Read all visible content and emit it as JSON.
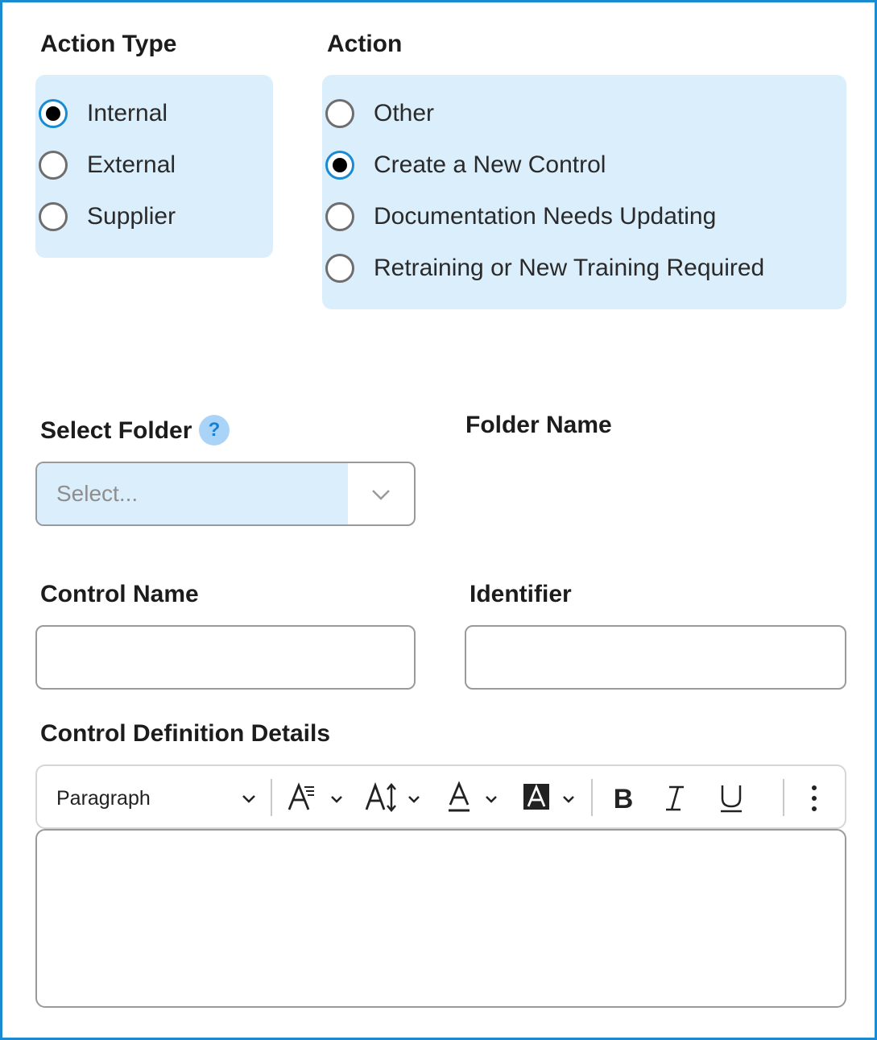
{
  "action_type": {
    "title": "Action Type",
    "options": [
      {
        "label": "Internal",
        "checked": true
      },
      {
        "label": "External",
        "checked": false
      },
      {
        "label": "Supplier",
        "checked": false
      }
    ]
  },
  "action": {
    "title": "Action",
    "options": [
      {
        "label": "Other",
        "checked": false
      },
      {
        "label": "Create a New Control",
        "checked": true
      },
      {
        "label": "Documentation Needs Updating",
        "checked": false
      },
      {
        "label": "Retraining or New Training Required",
        "checked": false
      }
    ]
  },
  "select_folder": {
    "label": "Select Folder",
    "help_icon": "?",
    "placeholder": "Select..."
  },
  "folder_name": {
    "label": "Folder Name"
  },
  "control_name": {
    "label": "Control Name",
    "value": ""
  },
  "identifier": {
    "label": "Identifier",
    "value": ""
  },
  "control_definition": {
    "label": "Control Definition Details",
    "toolbar": {
      "paragraph_label": "Paragraph",
      "icons": [
        "font-family-icon",
        "font-size-icon",
        "font-color-icon",
        "highlight-color-icon",
        "bold-icon",
        "italic-icon",
        "underline-icon",
        "more-icon"
      ]
    },
    "value": ""
  },
  "colors": {
    "accent": "#1a8ad1",
    "panel_bg": "#dbeefc",
    "border": "#9a9a9a"
  }
}
